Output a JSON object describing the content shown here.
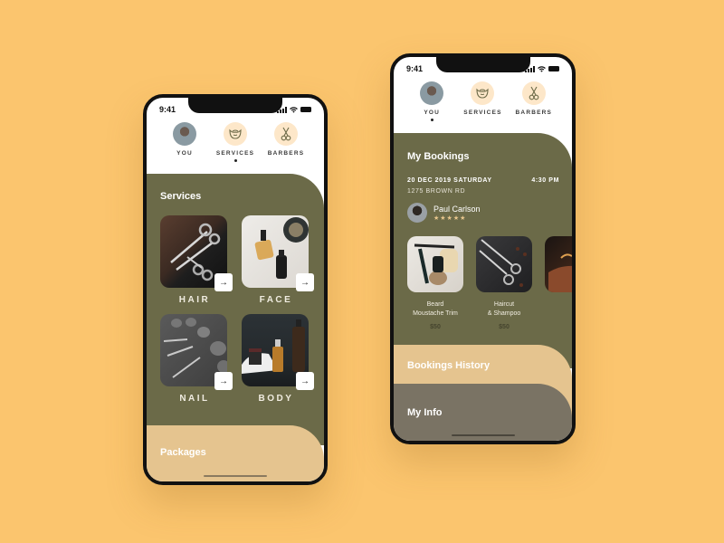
{
  "colors": {
    "background": "#fbc56e",
    "olive": "#6b6a48",
    "sand": "#e5c48f",
    "taupe": "#7a7364",
    "nav_circle": "#fde7c9"
  },
  "phone1": {
    "status": {
      "time": "9:41"
    },
    "nav": [
      {
        "label": "YOU",
        "icon": "avatar",
        "active": false
      },
      {
        "label": "SERVICES",
        "icon": "beard-icon",
        "active": true
      },
      {
        "label": "BARBERS",
        "icon": "scissors-icon",
        "active": false
      }
    ],
    "services": {
      "title": "Services",
      "items": [
        {
          "label": "HAIR",
          "image": "scissors-on-leather"
        },
        {
          "label": "FACE",
          "image": "oil-bottles-marble"
        },
        {
          "label": "NAIL",
          "image": "nail-tools-stones"
        },
        {
          "label": "BODY",
          "image": "body-products-dark"
        }
      ],
      "arrow": "→"
    },
    "packages": {
      "title": "Packages"
    }
  },
  "phone2": {
    "status": {
      "time": "9:41"
    },
    "nav": [
      {
        "label": "YOU",
        "icon": "avatar",
        "active": true
      },
      {
        "label": "SERVICES",
        "icon": "beard-icon",
        "active": false
      },
      {
        "label": "BARBERS",
        "icon": "scissors-icon",
        "active": false
      }
    ],
    "bookings": {
      "title": "My Bookings",
      "date": "20 DEC 2019 SATURDAY",
      "time": "4:30 PM",
      "address": "1275 BROWN RD",
      "barber": {
        "name": "Paul Carlson",
        "stars": "★★★★★",
        "rating": 5
      },
      "items": [
        {
          "name_line1": "Beard",
          "name_line2": "Moustache Trim",
          "price": "$50"
        },
        {
          "name_line1": "Haircut",
          "name_line2": "& Shampoo",
          "price": "$50"
        },
        {
          "name_line1": "",
          "name_line2": "",
          "price": ""
        }
      ]
    },
    "history": {
      "title": "Bookings History"
    },
    "info": {
      "title": "My Info"
    }
  }
}
